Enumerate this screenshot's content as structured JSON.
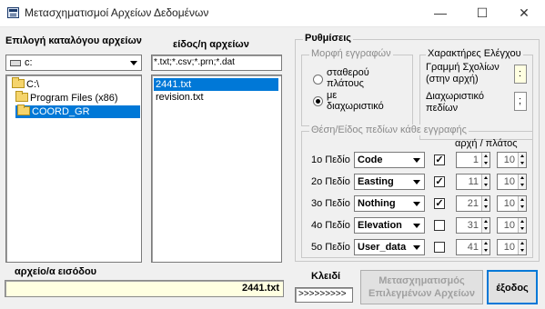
{
  "window": {
    "title": "Μετασχηματισμοί Αρχείων Δεδομένων",
    "minimize_glyph": "—",
    "maximize_glyph": "☐",
    "close_glyph": "✕"
  },
  "left_panel": {
    "dir_label": "Επιλογή καταλόγου αρχείων",
    "drive_value": "c:",
    "tree": [
      "C:\\",
      "Program Files (x86)",
      "COORD_GR"
    ],
    "selected_tree_index": 2,
    "input_files_label": "αρχείο/α εισόδου",
    "input_files_value": "2441.txt"
  },
  "file_panel": {
    "type_label": "είδος/η αρχείων",
    "filter_value": "*.txt;*.csv;*.prn;*.dat",
    "files": [
      "2441.txt",
      "revision.txt"
    ],
    "selected_file_index": 0
  },
  "settings": {
    "title": "Ρυθμίσεις",
    "record_format": {
      "title": "Μορφή εγγραφών",
      "options": [
        "σταθερού πλάτους",
        "με διαχωριστικό"
      ],
      "selected_index": 1
    },
    "control_chars": {
      "title": "Χαρακτήρες Ελέγχου",
      "comment_label": "Γραμμή Σχολίων (στην αρχή)",
      "comment_value": ":",
      "separator_label": "Διαχωριστικό πεδίων",
      "separator_value": ";"
    },
    "fields": {
      "title": "Θέση/Είδος πεδίων κάθε εγγραφής",
      "header_start_width": "αρχή / πλάτος",
      "rows": [
        {
          "label": "1ο Πεδίο",
          "type": "Code",
          "checked": true,
          "start": "1",
          "width": "10"
        },
        {
          "label": "2ο Πεδίο",
          "type": "Easting",
          "checked": true,
          "start": "11",
          "width": "10"
        },
        {
          "label": "3ο Πεδίο",
          "type": "Nothing",
          "checked": true,
          "start": "21",
          "width": "10"
        },
        {
          "label": "4ο Πεδίο",
          "type": "Elevation",
          "checked": false,
          "start": "31",
          "width": "10"
        },
        {
          "label": "5ο Πεδίο",
          "type": "User_data",
          "checked": false,
          "start": "41",
          "width": "10"
        }
      ]
    }
  },
  "bottom": {
    "key_label": "Κλειδί",
    "key_value": ">>>>>>>>>",
    "transform_button": "Μετασχηματισμός Επιλεγμένων Αρχείων",
    "exit_button": "έξοδος"
  }
}
